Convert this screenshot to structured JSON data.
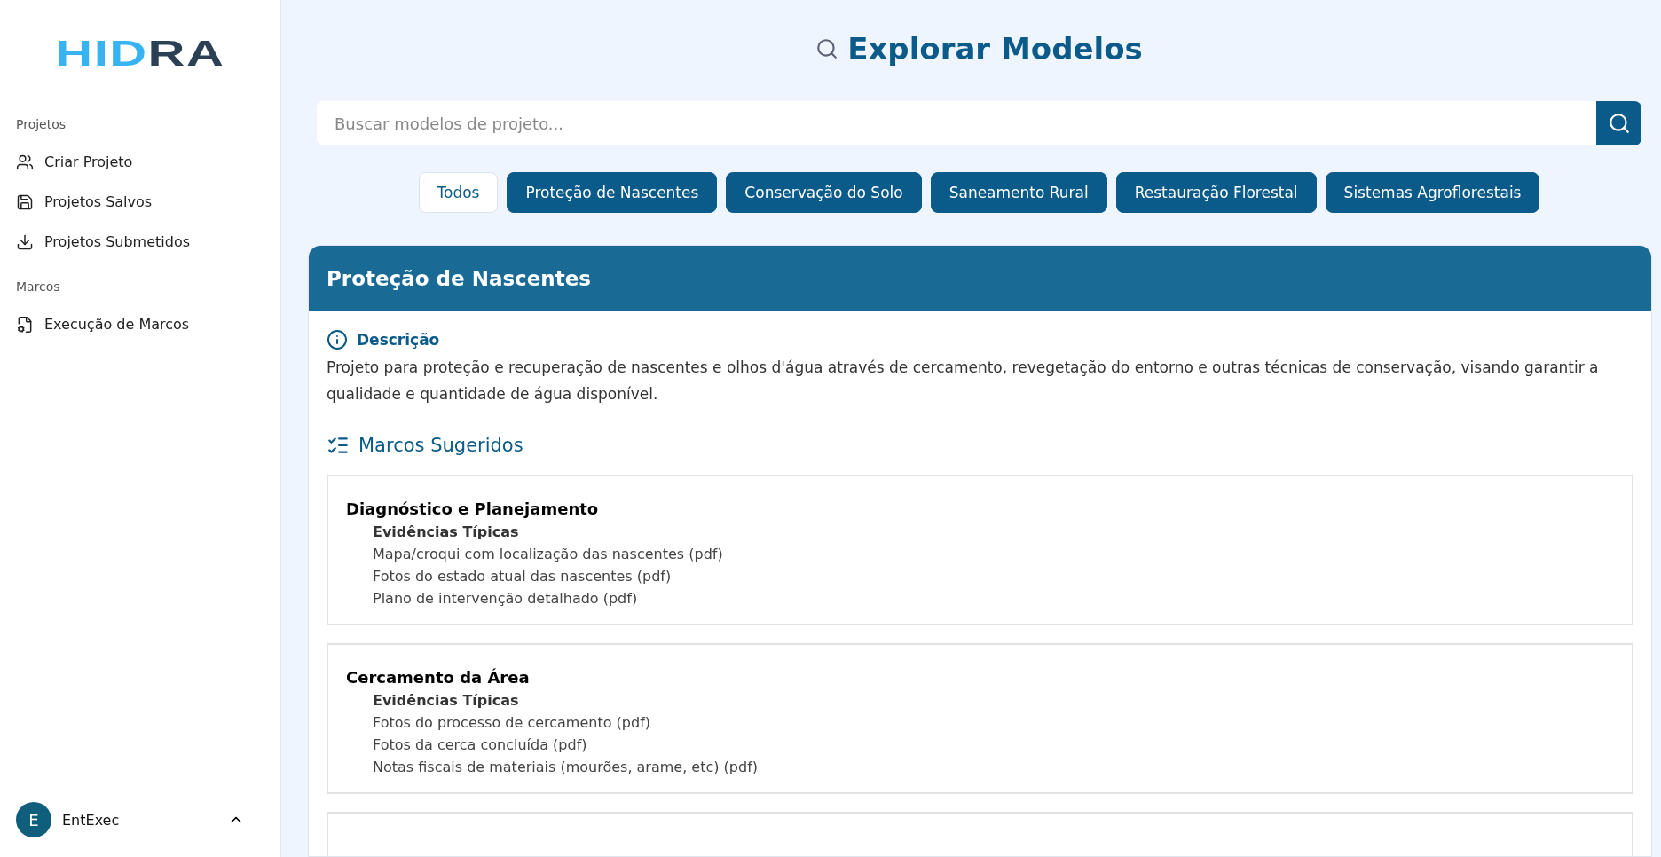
{
  "logo": "HIDRA",
  "sidebar": {
    "sections": [
      {
        "title": "Projetos",
        "items": [
          {
            "label": "Criar Projeto"
          },
          {
            "label": "Projetos Salvos"
          },
          {
            "label": "Projetos Submetidos"
          }
        ]
      },
      {
        "title": "Marcos",
        "items": [
          {
            "label": "Execução de Marcos"
          }
        ]
      }
    ],
    "user": {
      "initial": "E",
      "name": "EntExec",
      "expanded": true
    }
  },
  "page_title": "Explorar Modelos",
  "search": {
    "placeholder": "Buscar modelos de projeto..."
  },
  "filters": [
    {
      "label": "Todos",
      "selected": true
    },
    {
      "label": "Proteção de Nascentes",
      "selected": false
    },
    {
      "label": "Conservação do Solo",
      "selected": false
    },
    {
      "label": "Saneamento Rural",
      "selected": false
    },
    {
      "label": "Restauração Florestal",
      "selected": false
    },
    {
      "label": "Sistemas Agroflorestais",
      "selected": false
    }
  ],
  "model": {
    "title": "Proteção de Nascentes",
    "description_heading": "Descrição",
    "description": "Projeto para proteção e recuperação de nascentes e olhos d'água através de cercamento, revegetação do entorno e outras técnicas de conservação, visando garantir a qualidade e quantidade de água disponível.",
    "milestones_heading": "Marcos Sugeridos",
    "milestones": [
      {
        "title": "Diagnóstico e Planejamento",
        "evidence_heading": "Evidências Típicas",
        "evidence": [
          "Mapa/croqui com localização das nascentes (pdf)",
          "Fotos do estado atual das nascentes (pdf)",
          "Plano de intervenção detalhado (pdf)"
        ]
      },
      {
        "title": "Cercamento da Área",
        "evidence_heading": "Evidências Típicas",
        "evidence": [
          "Fotos do processo de cercamento (pdf)",
          "Fotos da cerca concluída (pdf)",
          "Notas fiscais de materiais (mourões, arame, etc) (pdf)"
        ]
      }
    ]
  }
}
